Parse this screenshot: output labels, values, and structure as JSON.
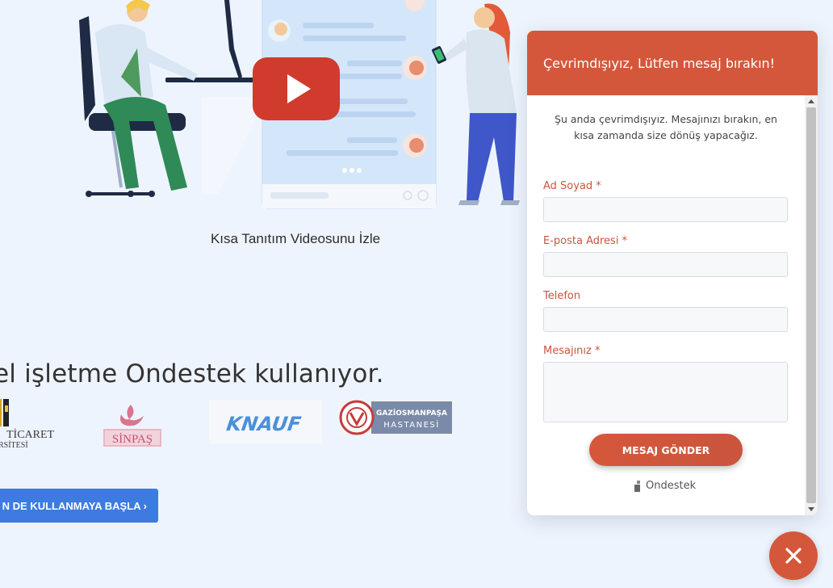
{
  "page": {
    "video_caption": "Kısa Tanıtım Videosunu İzle",
    "headline": "el işletme Ondestek kullanıyor.",
    "cta_label": "N DE KULLANMAYA BAŞLA ›",
    "logos": {
      "ticaret_line1": "TİCARET",
      "ticaret_line2": "RSİTESİ",
      "sinpas": "SİNPAŞ",
      "knauf": "KNAUF",
      "gop_line1": "GAZİOSMANPAŞA",
      "gop_line2": "HASTANESİ"
    }
  },
  "chat": {
    "header_title": "Çevrimdışıyız, Lütfen mesaj bırakın!",
    "intro_text": "Şu anda çevrimdışıyız. Mesajınızı bırakın, en kısa zamanda size dönüş yapacağız.",
    "fields": [
      {
        "label": "Ad Soyad *",
        "value": ""
      },
      {
        "label": "E-posta Adresi *",
        "value": ""
      },
      {
        "label": "Telefon",
        "value": ""
      },
      {
        "label": "Mesajınız *",
        "value": ""
      }
    ],
    "send_label": "MESAJ GÖNDER",
    "brand": "Ondestek",
    "close_icon": "close-icon"
  },
  "colors": {
    "accent": "#d5573b",
    "cta_blue": "#3d7be0",
    "background": "#eef4fd"
  }
}
